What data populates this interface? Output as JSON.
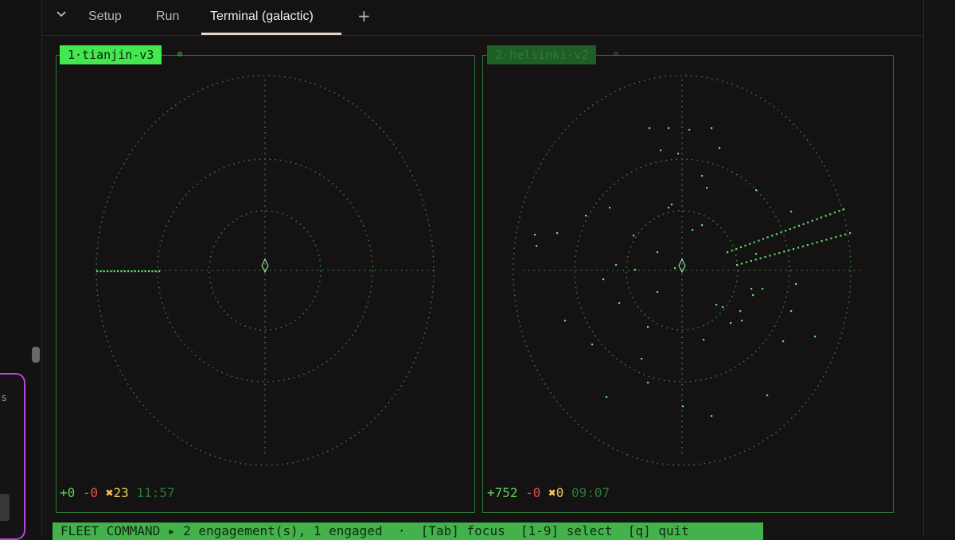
{
  "tabs": {
    "toggle_icon": "chevron-down-icon",
    "items": [
      {
        "label": "Setup"
      },
      {
        "label": "Run"
      },
      {
        "label": "Terminal (galactic)"
      }
    ],
    "add_label": "+"
  },
  "side_panel": {
    "glyph": "s"
  },
  "panes": [
    {
      "label": "1·tianjin-v3",
      "status": {
        "plus": "+0",
        "minus": "-0",
        "kills": "✖23",
        "time": "11:57"
      },
      "selected": true
    },
    {
      "label": "2·helsinki-v2",
      "status": {
        "plus": "+752",
        "minus": "-0",
        "kills": "✖0",
        "time": "09:07"
      },
      "selected": false
    }
  ],
  "fleet_bar": "FLEET COMMAND ▸ 2 engagement(s), 1 engaged  ·  [Tab] focus  [1-9] select  [q] quit",
  "colors": {
    "grid": "#2e7a35",
    "blip": "#5fe06a",
    "accent": "#42e84e",
    "center": "#9ad89f"
  }
}
